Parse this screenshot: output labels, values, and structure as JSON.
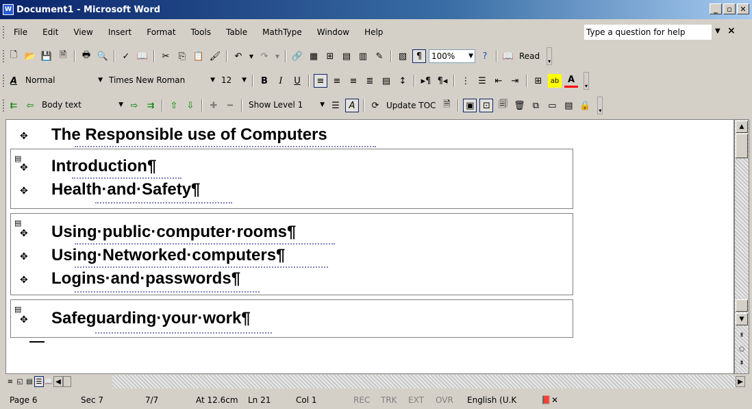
{
  "window": {
    "title": "Document1 - Microsoft Word",
    "app_icon": "word-icon",
    "minimize": "_",
    "restore": "▫",
    "close": "✕"
  },
  "menu": {
    "items": [
      "File",
      "Edit",
      "View",
      "Insert",
      "Format",
      "Tools",
      "Table",
      "MathType",
      "Window",
      "Help"
    ],
    "help_box": "Type a question for help",
    "help_close": "×"
  },
  "standard_toolbar": {
    "zoom": "100%",
    "read_label": "Read"
  },
  "formatting_toolbar": {
    "style": "Normal",
    "font": "Times New Roman",
    "size": "12",
    "bold": "B",
    "italic": "I",
    "underline": "U"
  },
  "outlining_toolbar": {
    "level_style": "Body text",
    "show_level": "Show Level 1",
    "update_toc": "Update TOC"
  },
  "document": {
    "main_heading": "The Responsible use of Computers",
    "subdocs": [
      {
        "headings": [
          "Introduction¶",
          "Health·and·Safety¶"
        ]
      },
      {
        "headings": [
          "Using·public·computer·rooms¶",
          "Using·Networked·computers¶",
          "Logins·and·passwords¶"
        ]
      },
      {
        "headings": [
          "Safeguarding·your·work¶"
        ]
      }
    ]
  },
  "status": {
    "page": "Page 6",
    "sec": "Sec 7",
    "pages": "7/7",
    "at": "At 12.6cm",
    "ln": "Ln 21",
    "col": "Col 1",
    "rec": "REC",
    "trk": "TRK",
    "ext": "EXT",
    "ovr": "OVR",
    "language": "English (U.K"
  },
  "colors": {
    "title_bar": "#0a246a",
    "chrome": "#d4d0c8",
    "document": "#ffffff"
  }
}
